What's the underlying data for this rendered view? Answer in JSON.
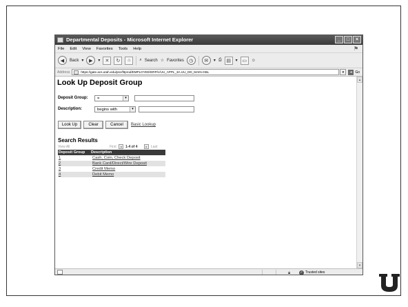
{
  "window": {
    "title": "Departmental Deposits - Microsoft Internet Explorer",
    "buttons": [
      "_",
      "□",
      "×"
    ]
  },
  "menu": [
    "File",
    "Edit",
    "View",
    "Favorites",
    "Tools",
    "Help"
  ],
  "toolbar": {
    "back_label": "Back",
    "search_label": "Search",
    "favorites_label": "Favorites"
  },
  "address": {
    "label": "Address",
    "url": "https://gate.acs.utah.edu/psc/f8prod/EMPLOYEE/ERP/c/UU_APPL_3A.UU_DD_MAIN.GBL",
    "go_label": "Go"
  },
  "page": {
    "title": "Look Up Deposit Group",
    "deposit_group_label": "Deposit Group:",
    "deposit_group_operator": "=",
    "description_label": "Description:",
    "description_operator": "begins with",
    "lookup_button": "Look Up",
    "clear_button": "Clear",
    "cancel_button": "Cancel",
    "basic_lookup_link": "Basic Lookup"
  },
  "results": {
    "title": "Search Results",
    "view_all": "View All",
    "first": "First",
    "range": "1-4 of 4",
    "last": "Last",
    "headers": [
      "Deposit Group",
      "Description"
    ],
    "rows": [
      {
        "code": "1",
        "description": "Cash, Coin, Check Deposit"
      },
      {
        "code": "2",
        "description": "Bank Card/Direct/Wire Deposit"
      },
      {
        "code": "3",
        "description": "Credit Memo"
      },
      {
        "code": "4",
        "description": "Debit Memo"
      }
    ]
  },
  "status": {
    "zone": "Trusted sites"
  }
}
